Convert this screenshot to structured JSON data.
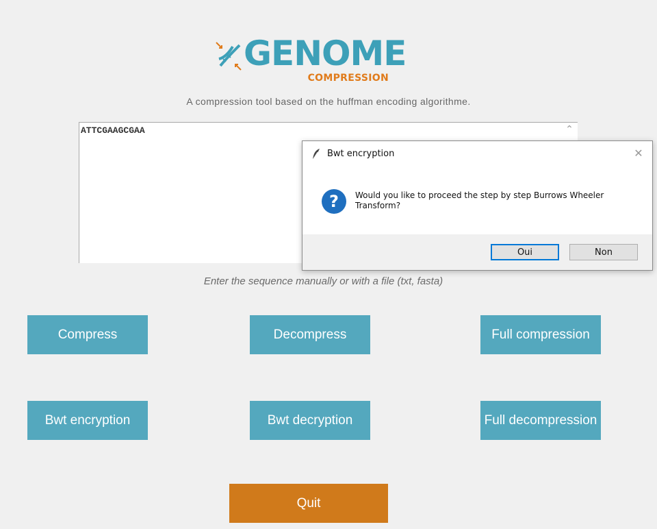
{
  "logo": {
    "word": "GENOME",
    "sub": "COMPRESSION"
  },
  "tagline": "A compression tool based on the huffman encoding algorithme.",
  "sequence_input": {
    "value": "ATTCGAAGCGAA"
  },
  "hint": "Enter the sequence manually or with a file (txt, fasta)",
  "buttons": {
    "compress": "Compress",
    "decompress": "Decompress",
    "full_compression": "Full compression",
    "bwt_encryption": "Bwt encryption",
    "bwt_decryption": "Bwt decryption",
    "full_decompression": "Full decompression",
    "quit": "Quit"
  },
  "dialog": {
    "title": "Bwt encryption",
    "message": "Would you like to proceed the step by step Burrows Wheeler Transform?",
    "yes_label": "Oui",
    "no_label": "Non",
    "close_glyph": "✕",
    "question_glyph": "?"
  },
  "colors": {
    "primary": "#54a8be",
    "accent": "#d07a1b",
    "logo_blue": "#3da0b8"
  }
}
